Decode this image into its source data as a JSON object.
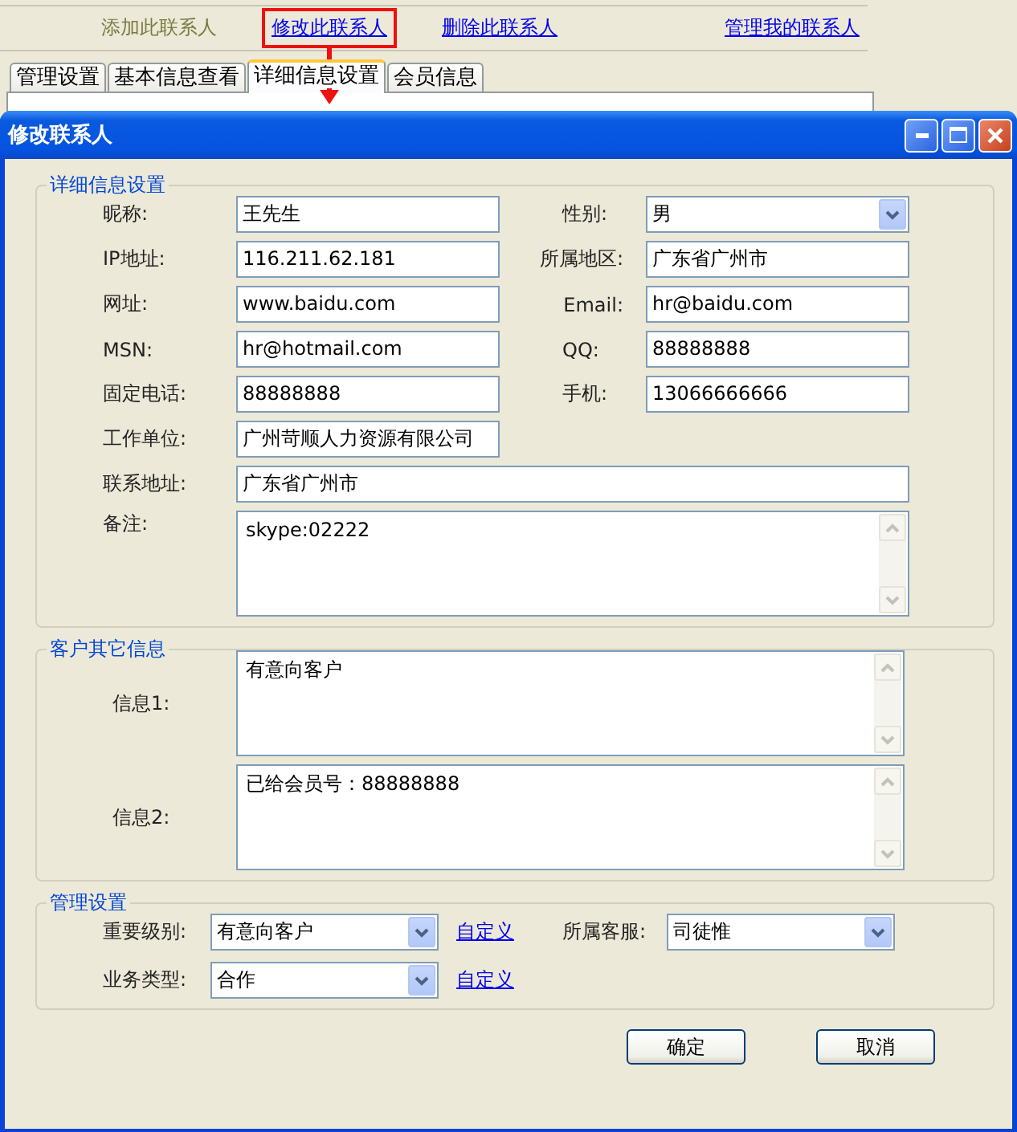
{
  "top_links": [
    {
      "label": "添加此联系人",
      "kind": "plain",
      "highlighted": false
    },
    {
      "label": "修改此联系人",
      "kind": "link",
      "highlighted": true
    },
    {
      "label": "删除此联系人",
      "kind": "link",
      "highlighted": false
    },
    {
      "label": "管理我的联系人",
      "kind": "link",
      "highlighted": false
    }
  ],
  "tabs": [
    {
      "label": "管理设置",
      "selected": false
    },
    {
      "label": "基本信息查看",
      "selected": false
    },
    {
      "label": "详细信息设置",
      "selected": true
    },
    {
      "label": "会员信息",
      "selected": false
    }
  ],
  "dialog": {
    "title": "修改联系人",
    "groups": [
      {
        "title": "详细信息设置",
        "kind": "form",
        "rows": [
          [
            {
              "label": "昵称:",
              "kind": "text",
              "value": "王先生"
            },
            {
              "label": "性别:",
              "kind": "select",
              "value": "男"
            }
          ],
          [
            {
              "label": "IP地址:",
              "kind": "text",
              "value": "116.211.62.181"
            },
            {
              "label": "所属地区:",
              "kind": "text",
              "value": "广东省广州市"
            }
          ],
          [
            {
              "label": "网址:",
              "kind": "text",
              "value": "www.baidu.com"
            },
            {
              "label": "Email:",
              "kind": "text",
              "value": "hr@baidu.com"
            }
          ],
          [
            {
              "label": "MSN:",
              "kind": "text",
              "value": "hr@hotmail.com"
            },
            {
              "label": "QQ:",
              "kind": "text",
              "value": "88888888"
            }
          ],
          [
            {
              "label": "固定电话:",
              "kind": "text",
              "value": "88888888"
            },
            {
              "label": "手机:",
              "kind": "text",
              "value": "13066666666"
            }
          ],
          [
            {
              "label": "工作单位:",
              "kind": "text",
              "value": "广州苛顺人力资源有限公司"
            }
          ],
          [
            {
              "label": "联系地址:",
              "kind": "long_text",
              "value": "广东省广州市"
            }
          ],
          [
            {
              "label": "备注:",
              "kind": "memo",
              "value": "skype:02222"
            }
          ]
        ]
      },
      {
        "title": "客户其它信息",
        "kind": "memos",
        "rows": [
          [
            {
              "label": "信息1:",
              "kind": "memo",
              "value": "有意向客户"
            }
          ],
          [
            {
              "label": "信息2:",
              "kind": "memo",
              "value": "已给会员号：88888888"
            }
          ]
        ]
      },
      {
        "title": "管理设置",
        "kind": "settings",
        "rows": [
          [
            {
              "label": "重要级别:",
              "kind": "select",
              "value": "有意向客户",
              "link": "自定义"
            },
            {
              "label": "所属客服:",
              "kind": "select",
              "value": "司徒惟"
            }
          ],
          [
            {
              "label": "业务类型:",
              "kind": "select",
              "value": "合作",
              "link": "自定义"
            }
          ]
        ]
      }
    ],
    "buttons": [
      "确定",
      "取消"
    ]
  }
}
